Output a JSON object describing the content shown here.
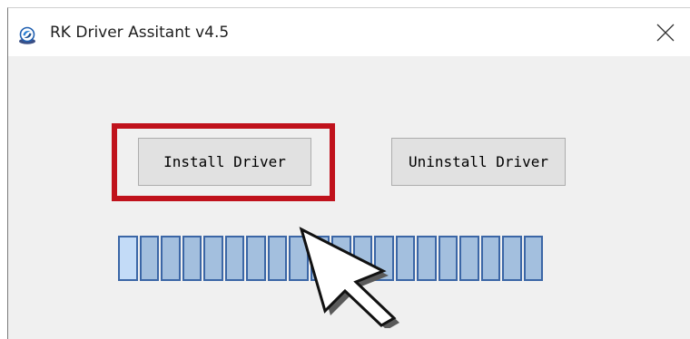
{
  "window": {
    "title": "RK Driver Assitant v4.5",
    "close_icon": "close-icon",
    "app_icon": "rk-app-icon"
  },
  "buttons": {
    "install_label": "Install Driver",
    "uninstall_label": "Uninstall Driver"
  },
  "progress": {
    "segment_count": 20,
    "active_segments": 1
  },
  "annotation": {
    "highlight_color": "#c0121c",
    "pointer_icon": "mouse-pointer-icon"
  }
}
